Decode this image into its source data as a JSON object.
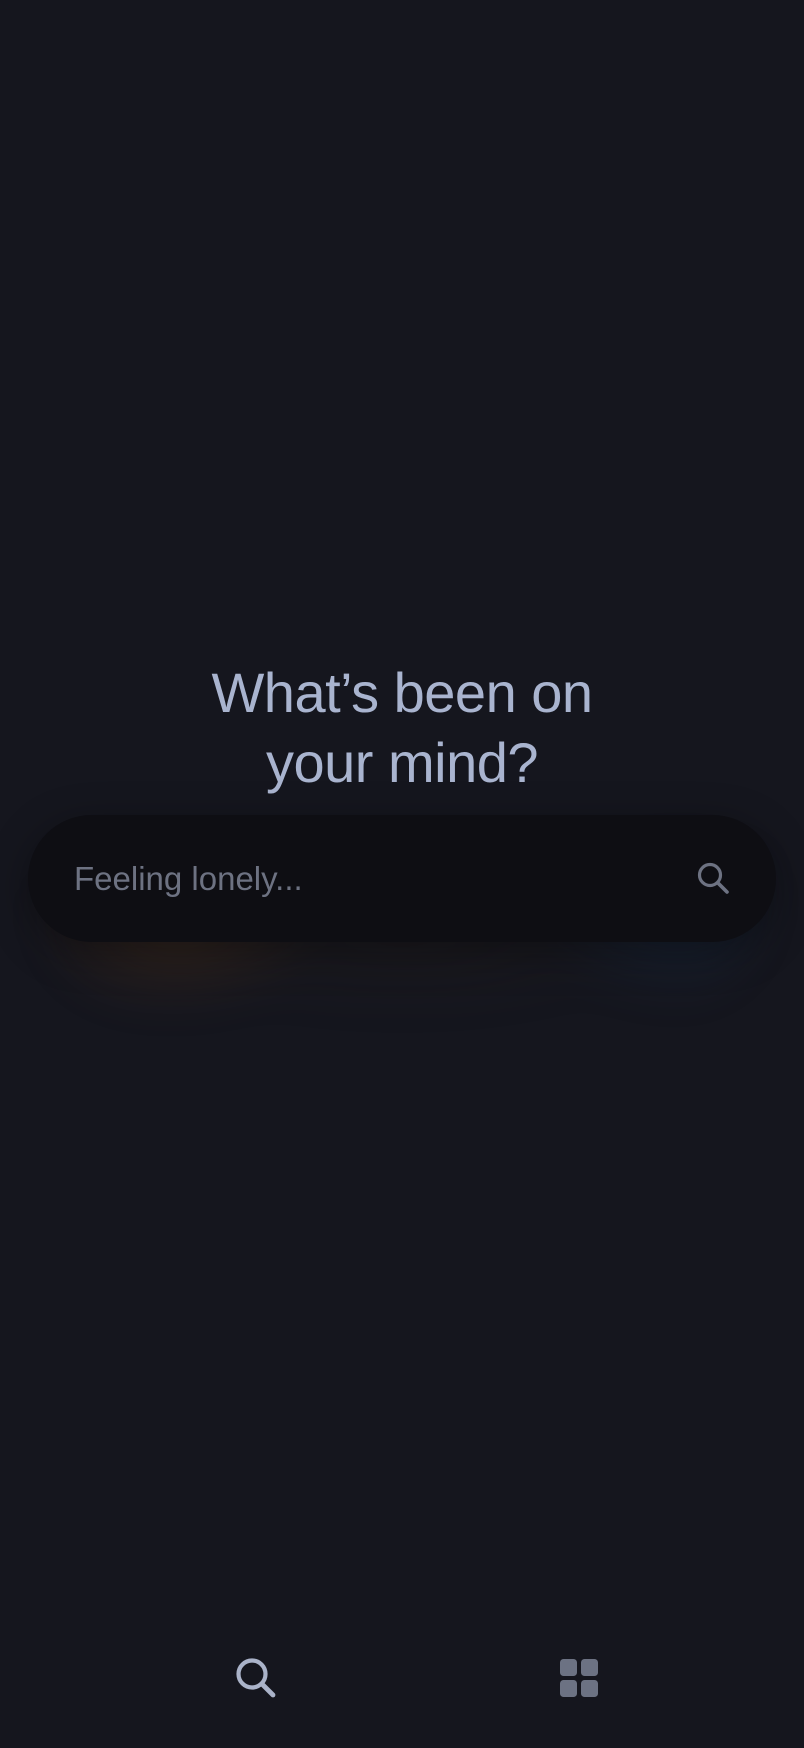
{
  "prompt": {
    "line1": "What’s been on",
    "line2": "your mind?"
  },
  "search": {
    "placeholder": "Feeling lonely...",
    "value": "",
    "button_icon": "search-icon"
  },
  "bottom_nav": {
    "items": [
      {
        "icon": "search-icon",
        "active": true
      },
      {
        "icon": "grid-icon",
        "active": false
      }
    ]
  },
  "colors": {
    "background": "#15161e",
    "headline": "#a9b4cf",
    "search_bar": "#0e0e13",
    "placeholder": "#6d7282",
    "icon_active": "#aab3c9",
    "icon_inactive": "#6c7283"
  }
}
